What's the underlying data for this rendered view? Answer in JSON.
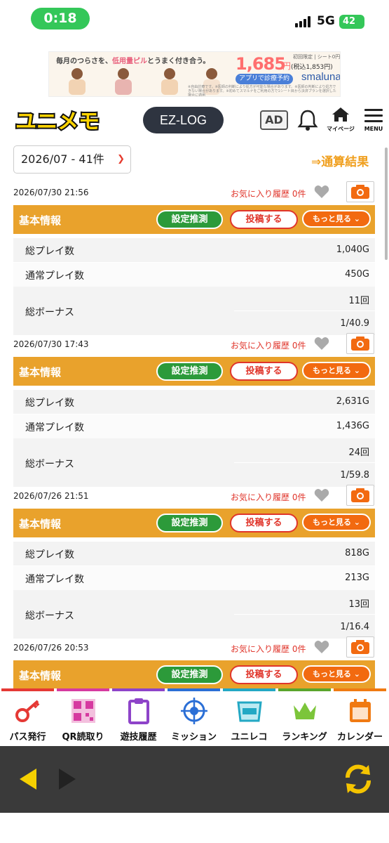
{
  "status_bar": {
    "time": "0:18",
    "network": "5G",
    "battery": "42"
  },
  "ad_banner": {
    "copy_prefix": "毎月のつらさを、",
    "copy_highlight": "低用量ピル",
    "copy_suffix": "とうまく付き合う。",
    "price": "1,685",
    "price_unit": "円",
    "tax": "(税込1,853円)",
    "small_note": "初回限定 | シート0円",
    "cta": "アプリで診療予約",
    "brand": "smaluna",
    "fine_print": "※自由診療です。※医師の判断により処方が可能な場合があります。※医師の判断により処方できない場合があります。※初めてスマルナをご利用の方で1シート目から決済プランを選択した場合に適用"
  },
  "header": {
    "logo_text": "ユニメモ",
    "ezlog": "EZ-LOG",
    "ad_label": "AD",
    "mypage": "マイページ",
    "menu": "MENU"
  },
  "content": {
    "period": "2026/07 - 41件",
    "total_link": "⇒通算結果",
    "records": [
      {
        "date": "2026/07/30 21:56",
        "fav": "お気に入り履歴 0件",
        "section_title": "基本情報",
        "btn_set": "設定推測",
        "btn_post": "投稿する",
        "btn_more": "もっと見る ⌄",
        "total_label": "総プレイ数",
        "total": "1,040G",
        "normal_label": "通常プレイ数",
        "normal": "450G",
        "bonus_label": "総ボーナス",
        "bonus_count": "11回",
        "bonus_rate": "1/40.9"
      },
      {
        "date": "2026/07/30 17:43",
        "fav": "お気に入り履歴 0件",
        "section_title": "基本情報",
        "btn_set": "設定推測",
        "btn_post": "投稿する",
        "btn_more": "もっと見る ⌄",
        "total_label": "総プレイ数",
        "total": "2,631G",
        "normal_label": "通常プレイ数",
        "normal": "1,436G",
        "bonus_label": "総ボーナス",
        "bonus_count": "24回",
        "bonus_rate": "1/59.8"
      },
      {
        "date": "2026/07/26 21:51",
        "fav": "お気に入り履歴 0件",
        "section_title": "基本情報",
        "btn_set": "設定推測",
        "btn_post": "投稿する",
        "btn_more": "もっと見る ⌄",
        "total_label": "総プレイ数",
        "total": "818G",
        "normal_label": "通常プレイ数",
        "normal": "213G",
        "bonus_label": "総ボーナス",
        "bonus_count": "13回",
        "bonus_rate": "1/16.4"
      },
      {
        "date": "2026/07/26 20:53",
        "fav": "お気に入り履歴 0件",
        "section_title": "基本情報",
        "btn_set": "設定推測",
        "btn_post": "投稿する",
        "btn_more": "もっと見る ⌄"
      }
    ]
  },
  "bottom_nav": [
    {
      "label": "パス発行",
      "icon": "key-icon",
      "color": "#e53935"
    },
    {
      "label": "QR読取り",
      "icon": "qr-code-icon",
      "color": "#d63aa0"
    },
    {
      "label": "遊技履歴",
      "icon": "clipboard-icon",
      "color": "#8e44c9"
    },
    {
      "label": "ミッション",
      "icon": "target-icon",
      "color": "#2b6fd6"
    },
    {
      "label": "ユニレコ",
      "icon": "unireco-icon",
      "color": "#23a8c4"
    },
    {
      "label": "ランキング",
      "icon": "crown-icon",
      "color": "#5aa52c"
    },
    {
      "label": "カレンダー",
      "icon": "calendar-icon",
      "color": "#f07a12"
    }
  ],
  "colors": {
    "accent_orange": "#e9a22c",
    "green": "#2c9a3a",
    "red": "#e0352b"
  }
}
